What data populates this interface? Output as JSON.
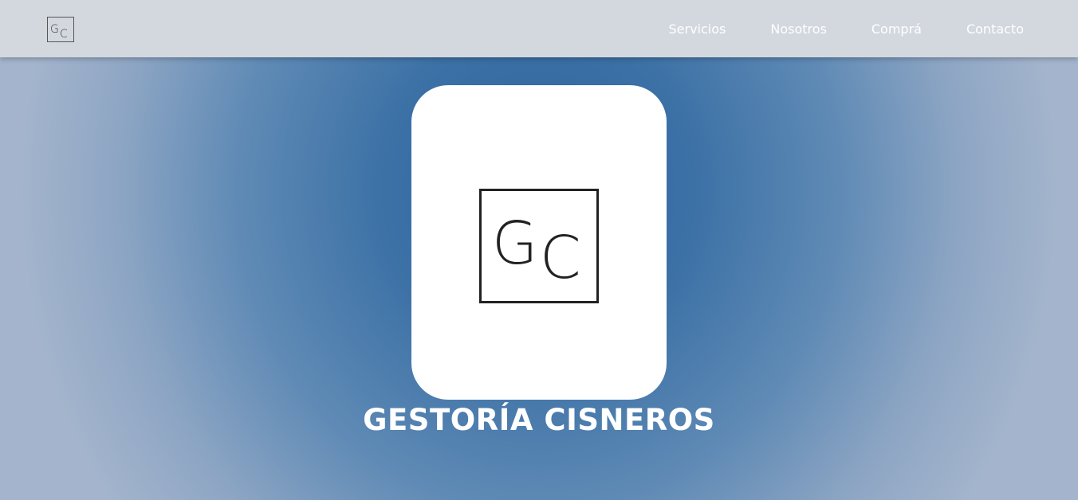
{
  "header": {
    "logo": {
      "icon": "gc-logo-icon",
      "text_g": "G",
      "text_c": "C"
    },
    "nav": [
      {
        "label": "Servicios"
      },
      {
        "label": "Nosotros"
      },
      {
        "label": "Comprá"
      },
      {
        "label": "Contacto"
      }
    ]
  },
  "hero": {
    "logo": {
      "icon": "gc-logo-icon",
      "text_g": "G",
      "text_c": "C"
    },
    "title": "GESTORÍA CISNEROS"
  },
  "colors": {
    "header_bg": "#d3d8df",
    "hero_center": "#2d64a0",
    "hero_edge": "#a3b4cc",
    "nav_text": "#ffffff",
    "logo_stroke": "#222222"
  }
}
